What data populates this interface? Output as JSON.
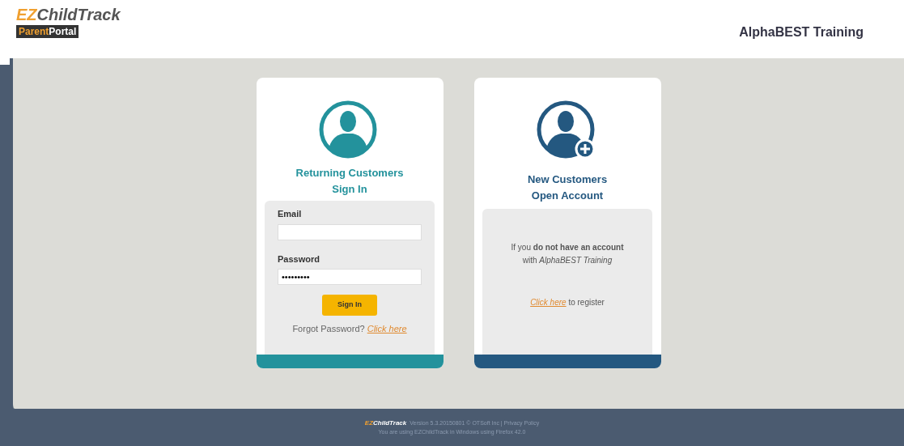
{
  "header": {
    "logo_ez": "EZ",
    "logo_rest": "ChildTrack",
    "logo_badge_a": "Parent",
    "logo_badge_b": "Portal",
    "organization": "AlphaBEST Training"
  },
  "signin": {
    "title_line1": "Returning Customers",
    "title_line2": "Sign In",
    "email_label": "Email",
    "password_label": "Password",
    "password_value": "•••••••••",
    "button": "Sign In",
    "forgot_text": "Forgot Password?",
    "forgot_link": "Click here"
  },
  "register": {
    "title_line1": "New Customers",
    "title_line2": "Open Account",
    "message_line1": "If you **do not have an account**",
    "message_line2": "with *AlphaBEST Training*",
    "link": "Click here",
    "link_suffix": "to register"
  },
  "footer": {
    "brand_ez": "EZ",
    "brand_rest": "ChildTrack",
    "version": "Version 5.3.20150801 © OTSoft Inc | Privacy Policy",
    "line2": "You are using EZChildTrack in Windows using Firefox 42.0"
  }
}
